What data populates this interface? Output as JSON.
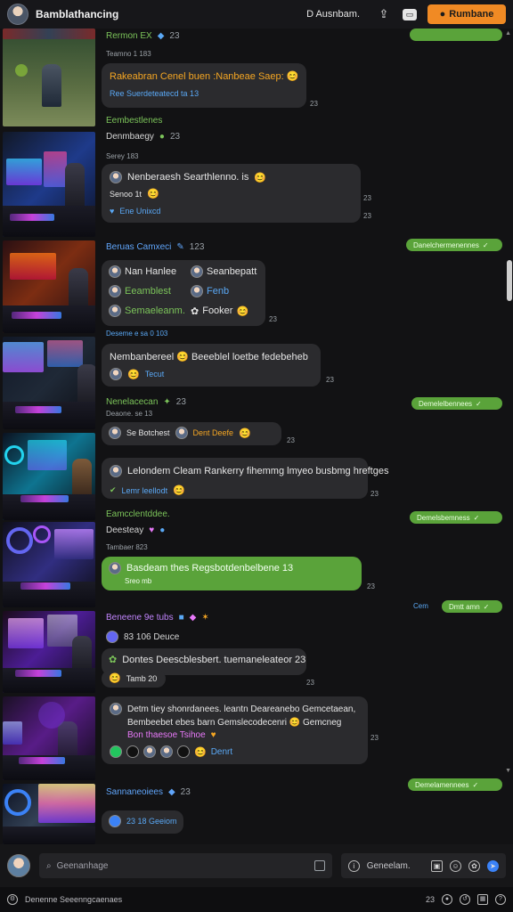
{
  "header": {
    "title": "Bamblathancing",
    "user_chip": "D  Ausnbam.",
    "cta_label": "Rumbane"
  },
  "rows": [
    {
      "meta": "Rermon EX",
      "sub": "Teamno 1 183",
      "bubble_lines": [
        "Rakeabran Cenel buen :Nanbeae Saep: 😊"
      ],
      "bubble_line2": "Ree Suerdeteatecd ta 13",
      "ts": "23",
      "out_pill": "",
      "meta_extra": "🔥",
      "meta_count": "23"
    }
  ],
  "row1": {
    "meta": "Rermon EX",
    "meta_count": "23",
    "sub": "Teamno 1 183",
    "bubble_text": "Rakeabran Cenel buen :Nanbeae Saep: 😊",
    "bubble_sub": "Ree Suerdeteatecd ta 13",
    "ts": "23",
    "pill": ""
  },
  "row2": {
    "meta": "Eembestlenes",
    "line2": "Denmbaegy",
    "line2_count": "23",
    "sub": "Serey 183",
    "bubble_name": "Nenberaesh Searthlenno. is",
    "bubble_mid": "Senoo 1t",
    "bubble_footer": "Ene Unixcd",
    "ts1": "23",
    "ts2": "23"
  },
  "row3": {
    "meta": "Beruas Camxeci",
    "meta_count": "123",
    "grid": [
      [
        "Nan Hanlee",
        "Seanbepatt"
      ],
      [
        "Eeamblest",
        "Fenb"
      ],
      [
        "Semaeleanm.",
        "Fooker"
      ]
    ],
    "ts": "23",
    "pill": "Danelchermenennes"
  },
  "row4": {
    "sub": "Deseme e sa 0 103",
    "bubble_text": "Nembanbereel 😊 Beeeblel loetbe fedebeheb",
    "bubble_sub": "Tecut",
    "ts": "23"
  },
  "row5": {
    "meta": "Nenelacecan",
    "sub": "Deaone. se 13",
    "meta_count": "23",
    "bubble_left": "Se Botchest",
    "bubble_right": "Dent Deefe",
    "ts": "23",
    "pill": "Demelelbennees"
  },
  "row6": {
    "bubble_text": "Lelondem Cleam Rankerry fihemmg lmyeo busbmg hreftges",
    "bubble_sub": "Lemr leellodt",
    "ts": "23"
  },
  "row7": {
    "meta": "Eamcclentddee.",
    "line2": "Deesteay",
    "sub": "Tambaer 823",
    "bubble_text": "Basdeam thes Regsbotdenbelbene 13",
    "bubble_sub": "Sreo mb",
    "ts": "23",
    "pill": "Demelsbemness",
    "out_label": "Cem",
    "out_pill": "Dmtt amn"
  },
  "row8": {
    "meta": "Beneene 9e tubs",
    "sub": "83 106 Deuce",
    "bubble_text": "Dontes Deescblesbert.  tuemaneleateor 23",
    "bubble_sub": "Tamb 20",
    "ts": "23"
  },
  "row9": {
    "line1": "Detm tiey shonrdanees. leantn Deareanebo Gemcetaean,",
    "line2": "Bembeebet ebes barn Gemslecodecenri 😊 Gemcneg",
    "line3": "Bon thaesoe Tsihoe",
    "footer_label": "Denrt",
    "ts": "23"
  },
  "row10": {
    "meta": "Sannaneoiees",
    "meta_count": "23",
    "bubble_text": "23 18 Geeiom",
    "pill": "Demelamennees"
  },
  "composer": {
    "placeholder": "Geenanhage",
    "tools_label": "Geneelam."
  },
  "footer": {
    "left": "Denenne Seeenngcaenaes",
    "right_count": "23"
  },
  "colors": {
    "accent_green": "#5aa33a",
    "accent_orange": "#f08a24",
    "bubble_dark": "#2b2b2e",
    "background": "#121214"
  }
}
